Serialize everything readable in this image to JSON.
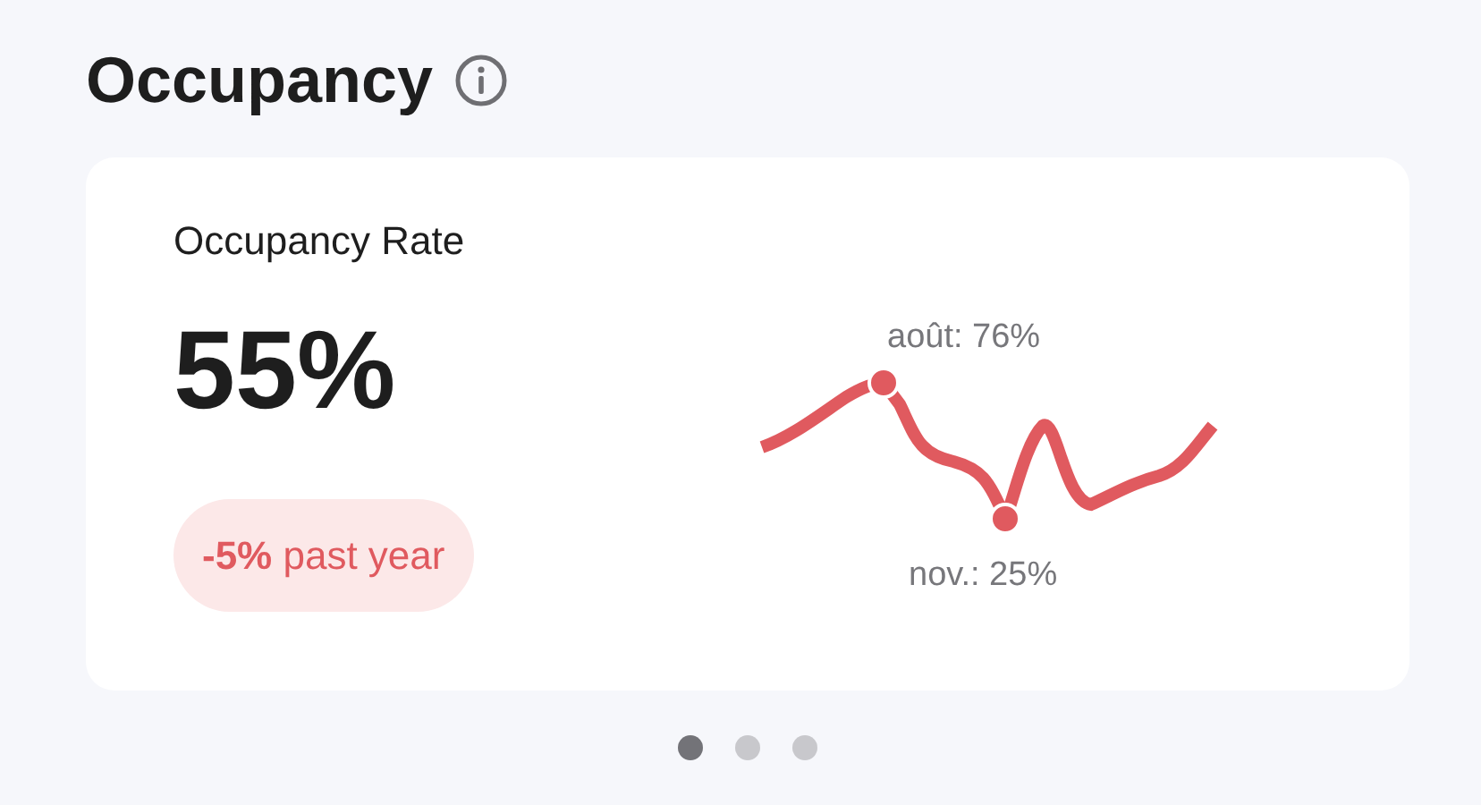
{
  "header": {
    "title": "Occupancy"
  },
  "card": {
    "title": "Occupancy Rate",
    "value": "55%",
    "change": {
      "text": "**-5%** past year",
      "negative": true
    },
    "sparkline": {
      "max_label": "août: 76%",
      "min_label": "nov.: 25%"
    }
  },
  "pager": [
    {
      "selected": true
    },
    {
      "selected": false
    },
    {
      "selected": false
    }
  ]
}
